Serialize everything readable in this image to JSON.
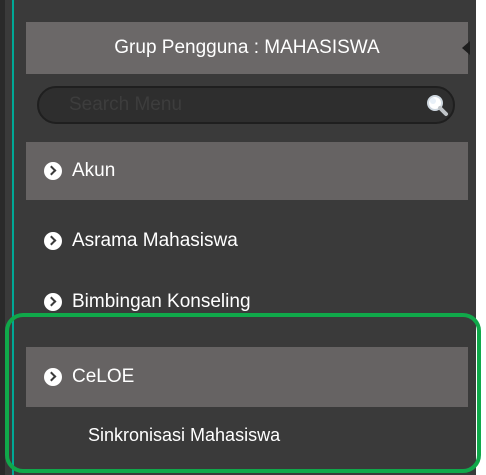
{
  "header": {
    "group_label": "Grup Pengguna : MAHASISWA"
  },
  "search": {
    "placeholder": "Search Menu",
    "value": ""
  },
  "menu": {
    "items": [
      {
        "label": "Akun"
      },
      {
        "label": "Asrama Mahasiswa"
      },
      {
        "label": "Bimbingan Konseling"
      },
      {
        "label": "CeLOE"
      }
    ],
    "submenu": [
      {
        "label": "Sinkronisasi Mahasiswa"
      }
    ]
  },
  "colors": {
    "panel": "#3a3a3a",
    "active_item": "#666363",
    "highlight_border": "#10a84a",
    "accent_line": "#00a896"
  }
}
